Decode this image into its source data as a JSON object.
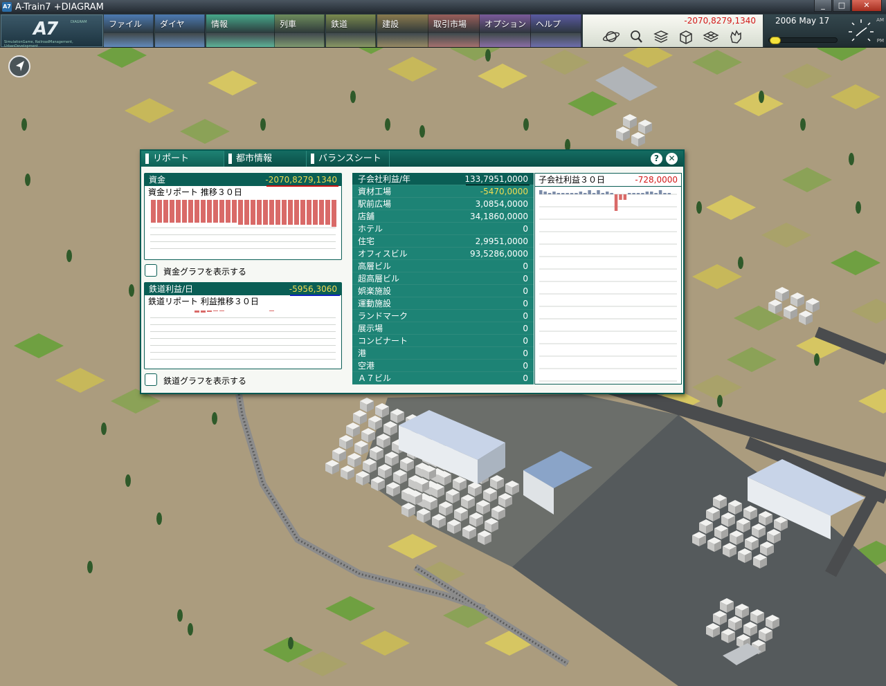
{
  "window": {
    "title": "A-Train7 +DIAGRAM",
    "app_icon": "A7",
    "controls": [
      "_",
      "□",
      "✕"
    ]
  },
  "brand": {
    "logo": "A7",
    "sub": "SimulationGame, RailroadManagement, UrbanDevelopment",
    "diagram": "DIAGRAM"
  },
  "menu": [
    {
      "label": "ファイル",
      "color": "#4d7ab2"
    },
    {
      "label": "ダイヤ",
      "color": "#4d7ab2"
    },
    {
      "label": "情報",
      "color": "#47a88a"
    },
    {
      "label": "列車",
      "color": "#6e8c5c"
    },
    {
      "label": "鉄道",
      "color": "#7a8a4e"
    },
    {
      "label": "建設",
      "color": "#8a7a4e"
    },
    {
      "label": "取引市場",
      "color": "#9a5e5a"
    },
    {
      "label": "オプション",
      "color": "#7a5a9a"
    },
    {
      "label": "ヘルプ",
      "color": "#5a5aa2"
    }
  ],
  "status": {
    "money": "-2070,8279,1340",
    "date": "2006  May 17",
    "am": "AM",
    "pm": "PM",
    "speed_level": 0.0
  },
  "tools": [
    "planet-icon",
    "magnifier-icon",
    "layers-icon",
    "buildings-icon",
    "grid-layers-icon",
    "hand-icon"
  ],
  "report": {
    "tabs": [
      "リポート",
      "都市情報",
      "バランスシート"
    ],
    "help": "?",
    "close": "✕",
    "funds": {
      "label": "資金",
      "value": "-2070,8279,1340",
      "subtitle": "資金リポート  推移３０日",
      "bars": [
        1,
        1,
        1,
        1,
        1,
        1,
        1,
        1,
        1,
        1,
        1,
        1,
        1,
        1,
        1.08,
        1.08,
        1.08,
        1.08,
        1.08,
        1.08,
        1.08,
        1.08,
        1.08,
        1.08,
        1.08,
        1.08,
        1.08,
        1.08,
        1.1,
        1.18
      ]
    },
    "funds_checkbox": "資金グラフを表示する",
    "rail": {
      "label": "鉄道利益/日",
      "value": "-5956,3060",
      "subtitle": "鉄道リポート  利益推移３０日",
      "bars": [
        0.15,
        0.15,
        0.15,
        0.15,
        0.15,
        0.15,
        0.15,
        0.5,
        0.5,
        0.4,
        0.2,
        0.2,
        0.15,
        0.15,
        0.15,
        0.1,
        0.1,
        0.1,
        0.1,
        0.2,
        0.15,
        0.15,
        0.15,
        0.15,
        0.15,
        0.15,
        0.15,
        0.15,
        0.15,
        0.15
      ]
    },
    "rail_checkbox": "鉄道グラフを表示する",
    "subsidiary_header": {
      "label": "子会社利益/年",
      "value": "133,7951,0000"
    },
    "subsidiaries": [
      {
        "label": "資材工場",
        "value": "-5470,0000",
        "negative": true
      },
      {
        "label": "駅前広場",
        "value": "3,0854,0000"
      },
      {
        "label": "店舗",
        "value": "34,1860,0000"
      },
      {
        "label": "ホテル",
        "value": "0"
      },
      {
        "label": "住宅",
        "value": "2,9951,0000"
      },
      {
        "label": "オフィスビル",
        "value": "93,5286,0000"
      },
      {
        "label": "高層ビル",
        "value": "0"
      },
      {
        "label": "超高層ビル",
        "value": "0"
      },
      {
        "label": "娯楽施設",
        "value": "0"
      },
      {
        "label": "運動施設",
        "value": "0"
      },
      {
        "label": "ランドマーク",
        "value": "0"
      },
      {
        "label": "展示場",
        "value": "0"
      },
      {
        "label": "コンビナート",
        "value": "0"
      },
      {
        "label": "港",
        "value": "0"
      },
      {
        "label": "空港",
        "value": "0"
      },
      {
        "label": "Ａ７ビル",
        "value": "0"
      }
    ],
    "sub30": {
      "label": "子会社利益３０日",
      "value": "-728,0000",
      "bars": [
        0.3,
        0.2,
        0.1,
        0.2,
        0.1,
        0.1,
        0.1,
        0.1,
        0.1,
        0.2,
        0.1,
        0.3,
        0.1,
        0.3,
        0.1,
        0.2,
        0.1,
        -1.2,
        -0.4,
        -0.4,
        0.1,
        0.1,
        0.1,
        0.1,
        0.2,
        0.2,
        0.1,
        0.3,
        0.1,
        0.1
      ]
    }
  }
}
